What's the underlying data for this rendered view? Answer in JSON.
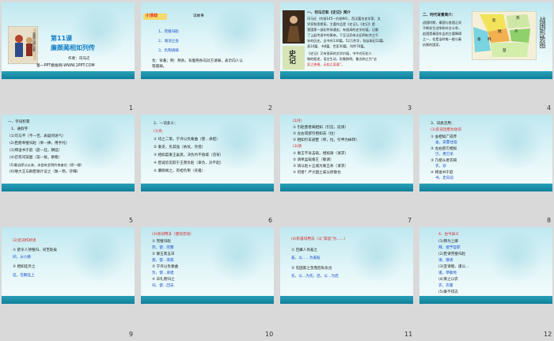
{
  "slides": [
    {
      "num": "1",
      "title": "第11课",
      "subtitle": "廉颇蔺相如列传",
      "author": "作者：司马迁",
      "site": "第一PPT模板网-WWW.1PPT.COM",
      "book_text": "我国古典名著",
      "theme": {
        "accent": "#0f7f9b",
        "title_color": "#1680c6"
      }
    },
    {
      "num": "2",
      "badge": "小活动",
      "heading": "读故事",
      "items": [
        "1、完璧归赵",
        "2、渑池之会",
        "3、负荆请罪"
      ],
      "body": [
        "负：背著；荆：荆条。背着荆条向对方请罪，表示向人认",
        "错赔罪。"
      ]
    },
    {
      "num": "3",
      "lines": [
        "一、司马迁和《史记》简介",
        "司马迁（约前145—约前90），西汉著名史学家、文",
        "学家和思想家。主要作品是《史记》。《史记》是",
        "我国第一部纪传体通史，有很高的史学价值，记载",
        "了上起传说中的黄帝，下至汉武帝太初四年共三千",
        "年的历史。全书共130篇，52万余字，包括本纪12篇、",
        "表10篇、书8篇、世家30篇、列传70篇。",
        "《史记》又有很高的文学价值，书中对历史人",
        "物的叙述，语言生动，形象鲜明。鲁迅称之为“史",
        "家之绝唱，无韵之离骚”。"
      ],
      "book": "史记"
    },
    {
      "num": "4",
      "lines": [
        "二、时代背景简介：",
        "战国时期，秦国与各国之间",
        "不断发生战争和外交斗争。",
        "赵国是秦国东出的主要障碍",
        "之一，也是当时唯一能与秦",
        "抗衡的国家。"
      ],
      "map_label": "战国形势图",
      "map_regions": [
        "赵",
        "魏",
        "韩",
        "楚",
        "齐",
        "秦",
        "燕"
      ]
    },
    {
      "num": "5",
      "lines": [
        "一、字词积累",
        "1、通假字",
        "(1)可与不（不—否，表疑问语气）",
        "(2)臣愿奉璧归赵（奉—捧，用手托）",
        "(3)拜送书于庭（庭—廷，朝廷）",
        "(4)召有司案图（案—按，察看）",
        "(5)秦自缪公以来，未尝有坚明约束者也（缪—穆）",
        "(6)唯大王与群臣孰计议之（孰—熟，仔细）"
      ]
    },
    {
      "num": "6",
      "lines": [
        "2、一词多义：",
        "(1)负",
        "① 均之二策，宁许以负秦曲（使…承担）",
        "② 秦贪，负其强（依仗，凭借）",
        "③ 相如度秦王虽斋，决负约不偿城（违背）",
        "④ 臣诚恐见欺于王而负赵（辜负，对不起）",
        "⑤ 廉颇闻之，肉袒负荆（背着）"
      ]
    },
    {
      "num": "7",
      "lines": [
        "(2)引",
        "① 引赵使者蔺相如（引见，延请）",
        "② 左右或欲引相如去（拉）",
        "③ 相如引车避匿（牵，拉，引申为掉转）",
        "(3)请",
        "① 秦王不肯击缻，相如请（请求）",
        "② 请奉盆缻秦王（敬请）",
        "③ 请以赵十五城为秦王寿（请求）",
        "④ 何者？严大国之威以修敬也"
      ]
    },
    {
      "num": "8",
      "lines": [
        "3、词类活用：",
        "(1)名词活用为动词",
        "① 舍相如广成传",
        "舍，安置住宿",
        "② 左右欲刃相如",
        "刃，用刀杀",
        "③ 乃使从者衣褐",
        "衣，穿",
        "④ 拜送书于庭",
        "书，走向前"
      ]
    },
    {
      "num": "9",
      "lines": [
        "(2)名词作状语",
        "① 欲令人持璧归，间至赵矣",
        "间，从小路",
        "② 相如廷斥之",
        "廷，在朝廷上"
      ]
    },
    {
      "num": "10",
      "lines": [
        "(3)动词用法（使动活动）",
        "① 完璧归赵",
        "完，使…完整",
        "② 秦王斋五日",
        "斋，使…斋戒",
        "③ 宁许以负秦曲",
        "负，使…承担",
        "④ 毕礼而归之",
        "归，使…回去"
      ]
    },
    {
      "num": "11",
      "lines": [
        "(4)形容词用法（以“其运”为……）",
        "① 且庸人尚羞之",
        "羞，以……为羞耻",
        "② 先国家之急而后私仇也",
        "先，以…为先；后，以…为后"
      ]
    },
    {
      "num": "12",
      "lines": [
        "4、古今异义",
        "(1)拜为上卿",
        "拜，授予官职",
        "(2)臣请完璧归赵",
        "请，敬请",
        "(3)宣请璧，谨以…",
        "谨，恭敬地",
        "(4)束之以衣",
        "衣，衣服",
        "(5)秦不得志",
        "得，得到"
      ]
    }
  ]
}
